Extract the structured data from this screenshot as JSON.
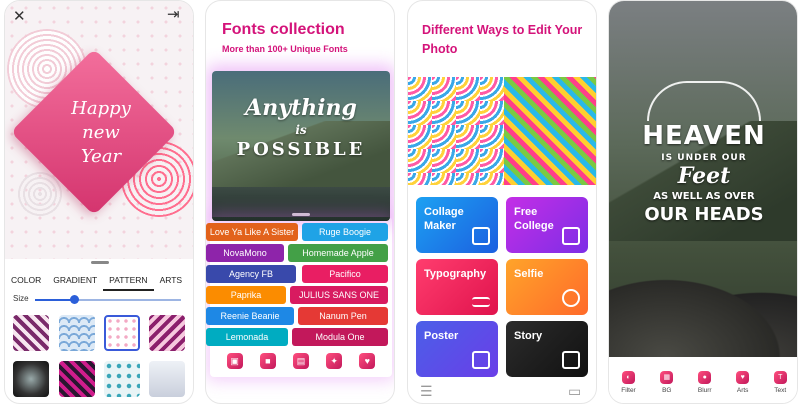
{
  "screen1": {
    "greeting": [
      "Happy",
      "new",
      "Year"
    ],
    "tabs": [
      "COLOR",
      "GRADIENT",
      "PATTERN",
      "ARTS"
    ],
    "active_tab": "PATTERN",
    "size_label": "Size",
    "size_value": 0.27,
    "icons": {
      "close": "close-icon",
      "export": "export-icon"
    }
  },
  "screen2": {
    "title": "Fonts collection",
    "subtitle": "More than 100+ Unique Fonts",
    "quote": [
      "Anything",
      "is",
      "POSSIBLE"
    ],
    "fonts": [
      {
        "label": "Love Ya Like A Sister",
        "color": "#e2621b"
      },
      {
        "label": "Ruge Boogie",
        "color": "#1fa3e6"
      },
      {
        "label": "NovaMono",
        "color": "#8e24aa"
      },
      {
        "label": "Homemade Apple",
        "color": "#43a047"
      },
      {
        "label": "Agency FB",
        "color": "#3949ab"
      },
      {
        "label": "Pacifico",
        "color": "#e91e63"
      },
      {
        "label": "Paprika",
        "color": "#fb8c00"
      },
      {
        "label": "JULIUS SANS ONE",
        "color": "#d81b60"
      },
      {
        "label": "Reenie Beanie",
        "color": "#1e88e5"
      },
      {
        "label": "Nanum Pen",
        "color": "#e53935"
      },
      {
        "label": "Lemonada",
        "color": "#00acc1"
      },
      {
        "label": "Modula One",
        "color": "#c2185b"
      }
    ]
  },
  "screen3": {
    "title": "Different Ways to Edit Your Photo",
    "cards": [
      "Collage Maker",
      "Free College",
      "Typography",
      "Selfie",
      "Poster",
      "Story"
    ]
  },
  "screen4": {
    "quote": [
      "HEAVEN",
      "IS UNDER OUR",
      "Feet",
      "AS WELL AS OVER",
      "OUR HEADS"
    ],
    "tools": [
      "Filter",
      "BG",
      "Blurr",
      "Arts",
      "Text"
    ]
  }
}
